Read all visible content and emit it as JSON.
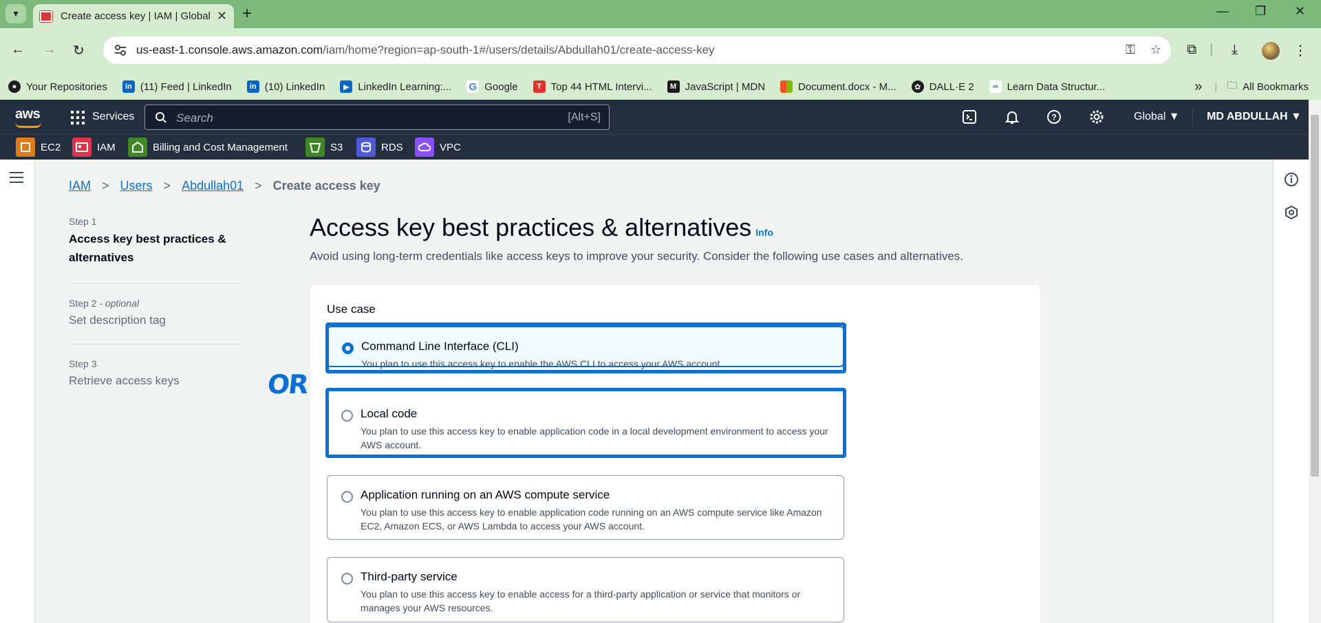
{
  "browser": {
    "tab_title": "Create access key | IAM | Global",
    "url_host": "us-east-1.console.aws.amazon.com",
    "url_path": "/iam/home?region=ap-south-1#/users/details/Abdullah01/create-access-key",
    "bookmarks": [
      {
        "label": "Your Repositories",
        "icon": "github-icon",
        "color": "#1f1f1f"
      },
      {
        "label": "(11) Feed | LinkedIn",
        "icon": "linkedin-icon",
        "color": "#0a66c2"
      },
      {
        "label": "(10) LinkedIn",
        "icon": "linkedin-icon",
        "color": "#0a66c2"
      },
      {
        "label": "LinkedIn Learning:...",
        "icon": "play-icon",
        "color": "#0a66c2"
      },
      {
        "label": "Google",
        "icon": "google-icon",
        "color": "#4285f4"
      },
      {
        "label": "Top 44 HTML Intervi...",
        "icon": "t-icon",
        "color": "#e0312a"
      },
      {
        "label": "JavaScript | MDN",
        "icon": "mdn-icon",
        "color": "#1b1b1b"
      },
      {
        "label": "Document.docx - M...",
        "icon": "microsoft-icon",
        "color": "#f25022"
      },
      {
        "label": "DALL·E 2",
        "icon": "openai-icon",
        "color": "#1f1f1f"
      },
      {
        "label": "Learn Data Structur...",
        "icon": "gfg-icon",
        "color": "#2f8d46"
      }
    ],
    "overflow": "»",
    "all_bookmarks": "All Bookmarks"
  },
  "aws": {
    "logo": "aws",
    "services_label": "Services",
    "search_placeholder": "Search",
    "search_shortcut": "[Alt+S]",
    "region": "Global ▼",
    "user": "MD ABDULLAH ▼",
    "favorites": [
      {
        "label": "EC2",
        "color": "#e07b1a"
      },
      {
        "label": "IAM",
        "color": "#dd344c"
      },
      {
        "label": "Billing and Cost Management",
        "color": "#3f8624"
      },
      {
        "label": "S3",
        "color": "#3f8624"
      },
      {
        "label": "RDS",
        "color": "#4d5bd6"
      },
      {
        "label": "VPC",
        "color": "#8c4fff"
      }
    ]
  },
  "breadcrumb": {
    "items": [
      "IAM",
      "Users",
      "Abdullah01"
    ],
    "current": "Create access key"
  },
  "steps": [
    {
      "num": "Step 1",
      "name": "Access key best practices & alternatives"
    },
    {
      "num": "Step 2",
      "optional": "- optional",
      "name": "Set description tag"
    },
    {
      "num": "Step 3",
      "name": "Retrieve access keys"
    }
  ],
  "main": {
    "title": "Access key best practices & alternatives",
    "info": "Info",
    "subtitle": "Avoid using long-term credentials like access keys to improve your security. Consider the following use cases and alternatives.",
    "use_case_label": "Use case",
    "options": [
      {
        "title": "Command Line Interface (CLI)",
        "desc": "You plan to use this access key to enable the AWS CLI to access your AWS account.",
        "selected": true
      },
      {
        "title": "Local code",
        "desc": "You plan to use this access key to enable application code in a local development environment to access your AWS account.",
        "selected": false
      },
      {
        "title": "Application running on an AWS compute service",
        "desc": "You plan to use this access key to enable application code running on an AWS compute service like Amazon EC2, Amazon ECS, or AWS Lambda to access your AWS account.",
        "selected": false
      },
      {
        "title": "Third-party service",
        "desc": "You plan to use this access key to enable access for a third-party application or service that monitors or manages your AWS resources.",
        "selected": false
      }
    ]
  },
  "annotation": {
    "text": "OR",
    "color": "#0a6fd6"
  }
}
